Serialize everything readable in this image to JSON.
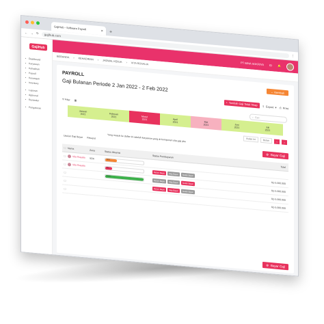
{
  "browser": {
    "tab_title": "GajiHub - Software Payroll",
    "new_tab": "+",
    "url": "gajihub.com"
  },
  "sidebar": {
    "logo": "GajiHub",
    "items": [
      {
        "label": "Dashboard",
        "icon": "dashboard-icon"
      },
      {
        "label": "Karyawan",
        "icon": "user-icon"
      },
      {
        "label": "Kehadiran",
        "icon": "calendar-icon"
      },
      {
        "label": "Payroll",
        "icon": "money-icon"
      },
      {
        "label": "Keuangan",
        "icon": "wallet-icon"
      },
      {
        "label": "Inventory",
        "icon": "box-icon"
      },
      {
        "label": "Laporan",
        "icon": "chart-icon"
      },
      {
        "label": "Approval",
        "icon": "check-icon"
      },
      {
        "label": "Reminder",
        "icon": "bell-icon"
      },
      {
        "label": "Pengaturan",
        "icon": "gear-icon"
      }
    ]
  },
  "topbar": {
    "company": "PT BINA SOKRIYA",
    "lang": "ID"
  },
  "breadcrumb": [
    "BERANDA",
    "KEHADIRAN",
    "JADWAL KERJA",
    "VITA ROSALIA"
  ],
  "page": {
    "title": "PAYROLL",
    "subtitle": "Gaji Bulanan Periode 2 Jan 2022 - 2 Feb 2022",
    "back_label": "Kembali",
    "tambah_label": "Tambah Gaji Tidak Tetap",
    "export_label": "Export",
    "print_label": "Print",
    "filter_label": "Filter",
    "search_placeholder": "Cari",
    "note": "Yang masuk ke daftar ini adalah karyawan yang di-komponen slip gaji pbs",
    "tab_a": "Usulan Gaji Bayar",
    "tab_b": "Riwayat",
    "bayar_label": "Bayar Gaji"
  },
  "months": [
    {
      "name": "Januari",
      "year": "2021",
      "color": "#d5ef8f"
    },
    {
      "name": "Februari",
      "year": "2021",
      "color": "#d5ef8f"
    },
    {
      "name": "Maret",
      "year": "2021",
      "color": "#e8325d"
    },
    {
      "name": "April",
      "year": "2021",
      "color": "#d5ef8f"
    },
    {
      "name": "Mei",
      "year": "2021",
      "color": "#f7b1bf"
    },
    {
      "name": "Juni",
      "year": "2021",
      "color": "#d5ef8f"
    },
    {
      "name": "Juli",
      "year": "2021",
      "color": "#d5ef8f"
    }
  ],
  "controls": {
    "year_label": "Bulan Ini",
    "sort_label": "Bulan"
  },
  "table": {
    "headers": [
      "Nama",
      "Zona",
      "Status Absensi",
      "Status Pembayaran",
      "Total"
    ],
    "rows": [
      {
        "name": "Vita Rosalia",
        "zona": "SDK",
        "absensi_pct": 0.3,
        "absensi_label": "30%",
        "bar_color": "#f58634",
        "tags": [],
        "total": ""
      },
      {
        "name": "Vita Rosalia",
        "zona": "",
        "absensi_pct": 0.1,
        "absensi_label": "5%",
        "bar_color": "#e8325d",
        "tags": [
          {
            "t": "Belum Bayar",
            "c": "#e8325d"
          },
          {
            "t": "Siap Bayar",
            "c": "#9a9a9a"
          },
          {
            "t": "Sudah Bayar",
            "c": "#9a9a9a"
          }
        ],
        "total": "Rp 5.000.000"
      },
      {
        "name": "",
        "zona": "",
        "absensi_pct": 1.0,
        "absensi_label": "100%",
        "bar_color": "#3cb04a",
        "tags": [
          {
            "t": "Belum Bayar",
            "c": "#9a9a9a"
          },
          {
            "t": "Siap Bayar",
            "c": "#9a9a9a"
          },
          {
            "t": "Sudah Bayar",
            "c": "#e8325d"
          }
        ],
        "total": "Rp 5.000.000"
      },
      {
        "name": "",
        "zona": "",
        "absensi_pct": 0,
        "absensi_label": "",
        "bar_color": "#ffffff",
        "tags": [
          {
            "t": "Belum Bayar",
            "c": "#e8325d"
          },
          {
            "t": "Siap Bayar",
            "c": "#e8325d"
          },
          {
            "t": "Sudah Bayar",
            "c": "#9a9a9a"
          }
        ],
        "total": "Rp 5.000.000"
      },
      {
        "name": "",
        "zona": "",
        "absensi_pct": 0,
        "absensi_label": "",
        "bar_color": "#ffffff",
        "tags": [],
        "total": "Rp 5.000.000"
      }
    ]
  }
}
